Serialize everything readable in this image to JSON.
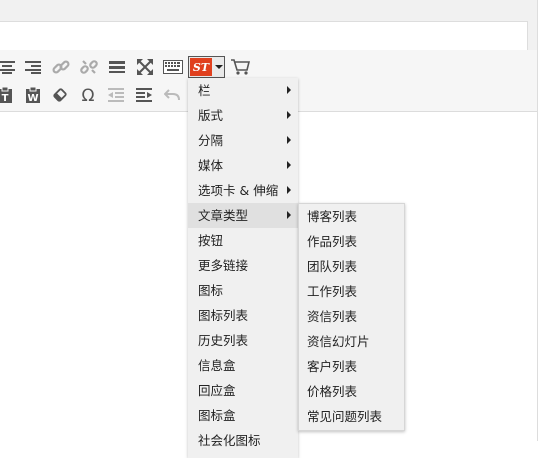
{
  "toolbar": {
    "row1_icons": [
      "align-center-icon",
      "align-right-icon",
      "link-icon",
      "unlink-icon",
      "horizontal-rule-icon",
      "fullscreen-icon",
      "keyboard-icon",
      "shortcodes-button",
      "cart-icon"
    ],
    "row2_icons": [
      "paste-text-icon",
      "paste-word-icon",
      "eraser-icon",
      "omega-icon",
      "outdent-icon",
      "indent-icon",
      "undo-icon"
    ],
    "st_label": "ST"
  },
  "menu": {
    "items": [
      {
        "label": "栏",
        "submenu": true
      },
      {
        "label": "版式",
        "submenu": true
      },
      {
        "label": "分隔",
        "submenu": true
      },
      {
        "label": "媒体",
        "submenu": true
      },
      {
        "label": "选项卡 & 伸缩",
        "submenu": true
      },
      {
        "label": "文章类型",
        "submenu": true,
        "active": true
      },
      {
        "label": "按钮",
        "submenu": false
      },
      {
        "label": "更多链接",
        "submenu": false
      },
      {
        "label": "图标",
        "submenu": false
      },
      {
        "label": "图标列表",
        "submenu": false
      },
      {
        "label": "历史列表",
        "submenu": false
      },
      {
        "label": "信息盒",
        "submenu": false
      },
      {
        "label": "回应盒",
        "submenu": false
      },
      {
        "label": "图标盒",
        "submenu": false
      },
      {
        "label": "社会化图标",
        "submenu": false
      }
    ]
  },
  "submenu": {
    "items": [
      "博客列表",
      "作品列表",
      "团队列表",
      "工作列表",
      "资信列表",
      "资信幻灯片",
      "客户列表",
      "价格列表",
      "常见问题列表"
    ]
  }
}
